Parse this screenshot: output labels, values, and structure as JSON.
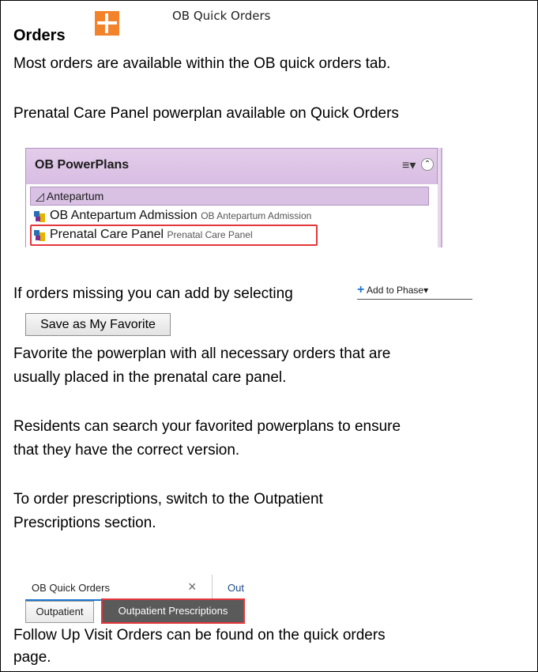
{
  "header": {
    "title": "Orders",
    "quick_orders_label": "OB Quick Orders"
  },
  "paragraphs": {
    "p1": "Most orders are available within the OB quick orders tab.",
    "p2": "Prenatal Care Panel powerplan available on Quick Orders",
    "p3": "If orders missing you can add by selecting",
    "p4_line1": "Favorite the powerplan with all necessary orders that are",
    "p4_line2": "usually placed in the prenatal care panel.",
    "p5_line1": "Residents can search your favorited powerplans to ensure",
    "p5_line2": "that they have the correct version.",
    "p6_line1": "To order prescriptions, switch to the Outpatient",
    "p6_line2": "Prescriptions section.",
    "p7_line1": "Follow Up Visit Orders can be found on the quick orders",
    "p7_line2": "page."
  },
  "powerplans": {
    "title": "OB PowerPlans",
    "section": "Antepartum",
    "items": [
      {
        "name": "OB Antepartum Admission",
        "sub": "OB Antepartum Admission"
      },
      {
        "name": "Prenatal Care Panel",
        "sub": "Prenatal Care Panel"
      }
    ]
  },
  "add_to_phase": {
    "label": "Add to Phase"
  },
  "favorite_button": {
    "label": "Save as My Favorite"
  },
  "tabs": {
    "active": "OB Quick Orders",
    "next_partial": "Out",
    "outpatient": "Outpatient",
    "outpatient_rx": "Outpatient Prescriptions"
  },
  "colors": {
    "icon_orange": "#f3832b",
    "highlight_red": "#e4373c",
    "panel_purple": "#d8bde3"
  }
}
